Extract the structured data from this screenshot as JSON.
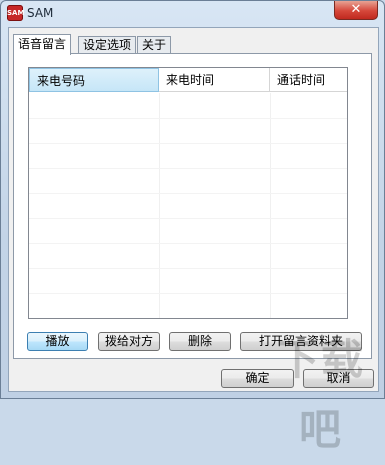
{
  "window": {
    "title": "SAM",
    "app_icon_text": "SAM",
    "close_glyph": "✕"
  },
  "tabs": [
    {
      "label": "语音留言",
      "active": true
    },
    {
      "label": "设定选项",
      "active": false
    },
    {
      "label": "关于",
      "active": false
    }
  ],
  "list": {
    "columns": [
      "来电号码",
      "来电时间",
      "通话时间",
      ""
    ],
    "rows": []
  },
  "actions": {
    "play": "播放",
    "dial_back": "拨给对方",
    "delete": "删除",
    "open_folder": "打开留言资料夹"
  },
  "dialog": {
    "ok": "确定",
    "cancel": "取消"
  },
  "watermark": {
    "text": "下载吧"
  }
}
